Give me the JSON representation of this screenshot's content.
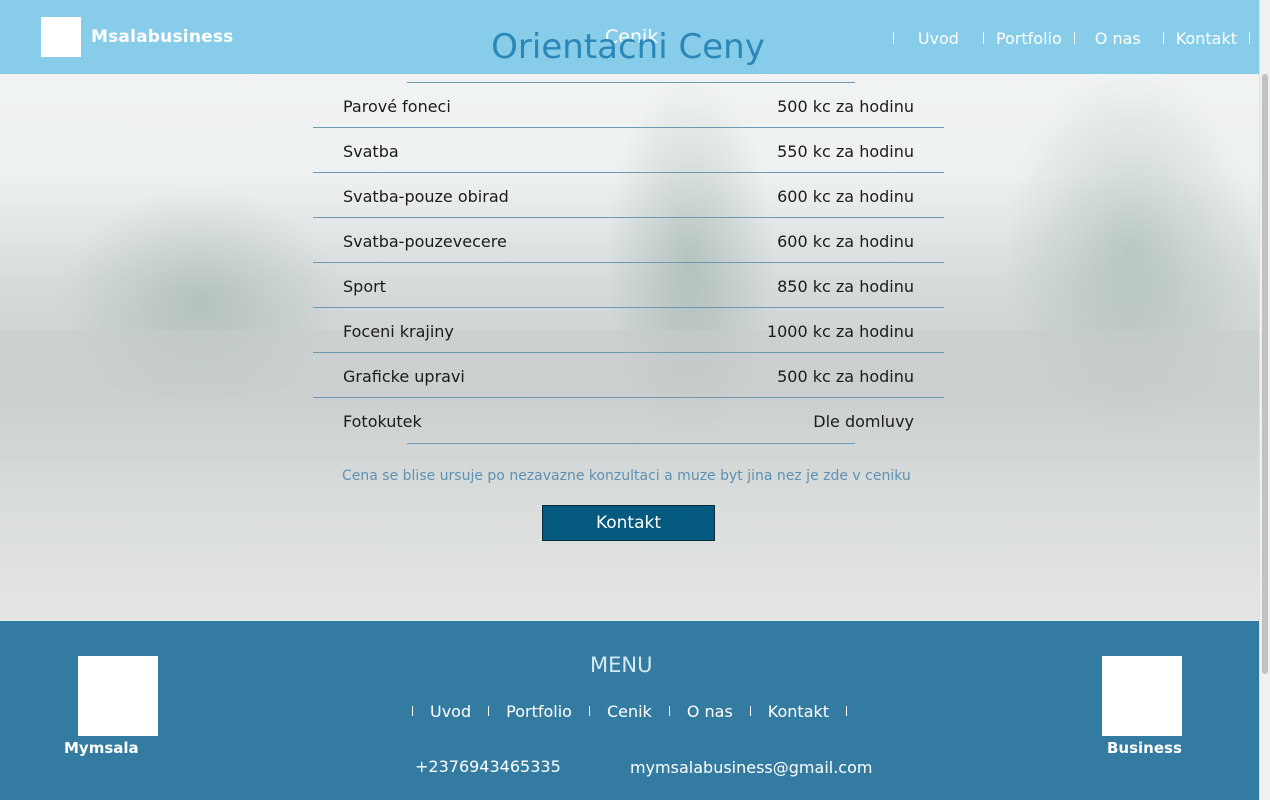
{
  "header": {
    "brand": "Msalabusiness",
    "active_page": "Cenik",
    "nav": [
      "Uvod",
      "Portfolio",
      "O nas",
      "Kontakt"
    ]
  },
  "main": {
    "title": "Orientacni Ceny",
    "prices": [
      {
        "service": "Parové foneci",
        "price": "500 kc za hodinu"
      },
      {
        "service": "Svatba",
        "price": "550 kc za hodinu"
      },
      {
        "service": "Svatba-pouze obirad",
        "price": "600 kc za hodinu"
      },
      {
        "service": "Svatba-pouzevecere",
        "price": "600 kc za hodinu"
      },
      {
        "service": "Sport",
        "price": "850 kc za hodinu"
      },
      {
        "service": "Foceni krajiny",
        "price": "1000 kc za hodinu"
      },
      {
        "service": "Graficke upravi",
        "price": "500 kc za hodinu"
      },
      {
        "service": "Fotokutek",
        "price": "Dle domluvy"
      }
    ],
    "note": "Cena se blise ursuje po nezavazne konzultaci a muze byt jina nez je zde v ceniku",
    "button_label": "Kontakt"
  },
  "footer": {
    "left_name": "Mymsala",
    "right_name": "Business",
    "menu_title": "MENU",
    "nav": [
      "Uvod",
      "Portfolio",
      "Cenik",
      "O nas",
      "Kontakt"
    ],
    "phone": "+2376943465335",
    "email": "mymsalabusiness@gmail.com"
  },
  "colors": {
    "header_bg": "#87cde9",
    "footer_bg": "#337ba0",
    "title": "#2b87b7",
    "button_bg": "#04597f"
  }
}
